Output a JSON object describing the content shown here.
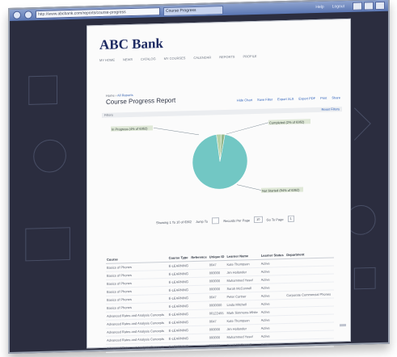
{
  "app": {
    "title": "ABC Bank"
  },
  "browser": {
    "address": "http://www.abcbank.com/reports/course-progress",
    "tab_label": "Course Progress",
    "top_links": [
      "Help",
      "Logout"
    ]
  },
  "nav": {
    "items": [
      "MY HOME",
      "NEWS",
      "CATALOG",
      "MY COURSES",
      "CALENDAR",
      "REPORTS",
      "PROFILE"
    ]
  },
  "breadcrumb": {
    "prefix": "Home ›",
    "link": "All Reports"
  },
  "page": {
    "title": "Course Progress Report"
  },
  "actions": [
    "Hide Chart",
    "Save Filter",
    "Export XLS",
    "Export PDF",
    "Print",
    "Share"
  ],
  "filter": {
    "label": "Filters",
    "reset": "Reset Filters"
  },
  "pager": {
    "showing": "Showing 1 To 10 of 6362",
    "jump": "Jump To",
    "per_page_label": "Records Per Page",
    "per_page": "10",
    "page_label": "Go To Page",
    "page": "1"
  },
  "chart_data": {
    "type": "pie",
    "categories": [
      "In Progress",
      "Completed",
      "Not Started"
    ],
    "values": [
      3,
      2,
      95
    ],
    "title": "",
    "labels": [
      "In Progress (4% of 6362)",
      "Completed (2% of 6362)",
      "Not Started (94% of 6362)"
    ]
  },
  "table": {
    "columns": [
      "Course",
      "Course Type",
      "Reference",
      "Unique ID",
      "Learner Name",
      "Learner Status",
      "Department"
    ],
    "rows": [
      [
        "Basics of Phones",
        "E-LEARNING",
        "",
        "0047",
        "Kate Thompson",
        "Active",
        ""
      ],
      [
        "Basics of Phones",
        "E-LEARNING",
        "",
        "000000",
        "Jim Hollander",
        "Active",
        ""
      ],
      [
        "Basics of Phones",
        "E-LEARNING",
        "",
        "000000",
        "Mohammed Yusuf",
        "Active",
        ""
      ],
      [
        "Basics of Phones",
        "E-LEARNING",
        "",
        "000000",
        "Sarah McConnell",
        "Active",
        ""
      ],
      [
        "Basics of Phones",
        "E-LEARNING",
        "",
        "0047",
        "Peter Cartner",
        "Active",
        "Corporate Commercial Phones"
      ],
      [
        "Basics of Phones",
        "E-LEARNING",
        "",
        "0000000",
        "Linda Mitchell",
        "Active",
        ""
      ],
      [
        "Advanced Rates and Analysis Concepts",
        "E-LEARNING",
        "",
        "00122455",
        "Mark Simmons-White",
        "Active",
        ""
      ],
      [
        "Advanced Rates and Analysis Concepts",
        "E-LEARNING",
        "",
        "0047",
        "Kate Thompson",
        "Active",
        ""
      ],
      [
        "Advanced Rates and Analysis Concepts",
        "E-LEARNING",
        "",
        "000000",
        "Jim Hollander",
        "Active",
        ""
      ],
      [
        "Advanced Rates and Analysis Concepts",
        "E-LEARNING",
        "",
        "000000",
        "Mohammed Yusuf",
        "Active",
        ""
      ],
      [
        "Advanced Rates and Analysis Concepts",
        "E-LEARNING",
        "",
        "000000",
        "Sarah McConnell",
        "Active",
        ""
      ]
    ]
  }
}
